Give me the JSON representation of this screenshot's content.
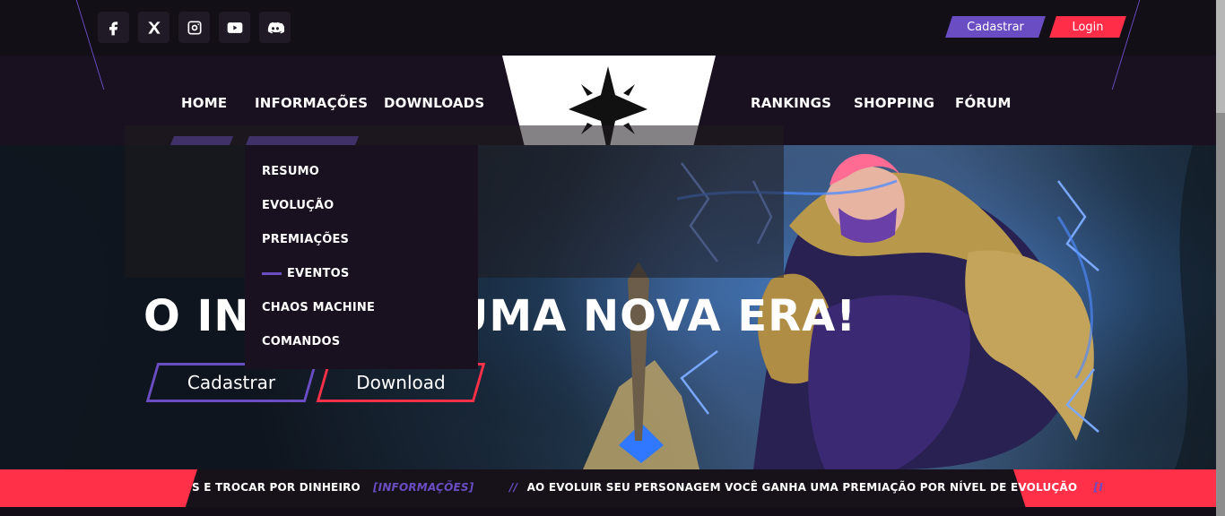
{
  "header": {
    "register_label": "Cadastrar",
    "login_label": "Login"
  },
  "nav": {
    "home": "HOME",
    "informacoes": "INFORMAÇÕES",
    "downloads": "DOWNLOADS",
    "rankings": "RANKINGS",
    "shopping": "SHOPPING",
    "forum": "FÓRUM"
  },
  "dropdown": {
    "items": [
      "RESUMO",
      "EVOLUÇÃO",
      "PREMIAÇÕES",
      "EVENTOS",
      "CHAOS MACHINE",
      "COMANDOS"
    ]
  },
  "hero": {
    "title": "O INÍCIO DE UMA NOVA ERA!",
    "cadastrar": "Cadastrar",
    "download": "Download"
  },
  "ticker": {
    "left": "S E TROCAR POR DINHEIRO",
    "left_tag": "[INFORMAÇÕES]",
    "sep": "//",
    "right": "AO EVOLUIR SEU PERSONAGEM VOCÊ GANHA UMA PREMIAÇÃO POR NÍVEL DE EVOLUÇÃO",
    "right_tag": "[I"
  }
}
